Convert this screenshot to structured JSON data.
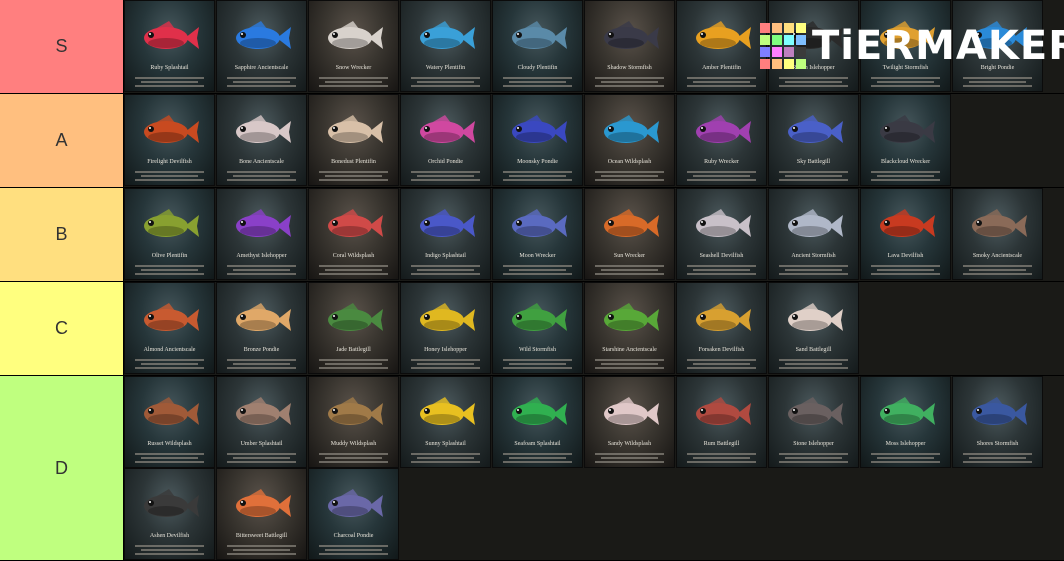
{
  "logo": {
    "text": "TiERMAKER",
    "grid_colors": [
      "#ff7f7f",
      "#ffbf7f",
      "#ffdf7f",
      "#ffff7f",
      "#bfff7f",
      "#7fff7f",
      "#7fffff",
      "#7fbfff",
      "#7f7fff",
      "#ff7fff",
      "#bf7fbf",
      "#3b3b3b",
      "#ff7f7f",
      "#ffbf7f",
      "#ffff7f",
      "#bfff7f"
    ]
  },
  "tiers": [
    {
      "label": "S",
      "color": "#ff7f7f",
      "items": [
        {
          "name": "Ruby Splashtail",
          "color": "#e0304a"
        },
        {
          "name": "Sapphire Ancientscale",
          "color": "#2a7ae0"
        },
        {
          "name": "Snow Wrecker",
          "color": "#d8d2cc"
        },
        {
          "name": "Watery Plentifin",
          "color": "#3aa0d8"
        },
        {
          "name": "Cloudy Plentifin",
          "color": "#5a8aa8"
        },
        {
          "name": "Shadow Stormfish",
          "color": "#3a3a48"
        },
        {
          "name": "Amber Plentifin",
          "color": "#e8a020"
        },
        {
          "name": "Raven Islehopper",
          "color": "#2a2a2a"
        },
        {
          "name": "Twilight Stormfish",
          "color": "#e0a030"
        },
        {
          "name": "Bright Pondie",
          "color": "#2a8ad8"
        }
      ]
    },
    {
      "label": "A",
      "color": "#ffbf7f",
      "items": [
        {
          "name": "Firelight Devilfish",
          "color": "#c84a20"
        },
        {
          "name": "Bone Ancientscale",
          "color": "#d8c8c8"
        },
        {
          "name": "Bonedust Plentifin",
          "color": "#d8c0a8"
        },
        {
          "name": "Orchid Pondie",
          "color": "#d048a0"
        },
        {
          "name": "Moonsky Pondie",
          "color": "#3a48c0"
        },
        {
          "name": "Ocean Wildsplash",
          "color": "#2a98d0"
        },
        {
          "name": "Ruby Wrecker",
          "color": "#a040b0"
        },
        {
          "name": "Sky Battlegill",
          "color": "#4a60c8"
        },
        {
          "name": "Blackcloud Wrecker",
          "color": "#3a3a44"
        }
      ]
    },
    {
      "label": "B",
      "color": "#ffdf7f",
      "items": [
        {
          "name": "Olive Plentifin",
          "color": "#88a030"
        },
        {
          "name": "Amethyst Islehopper",
          "color": "#8a40c8"
        },
        {
          "name": "Coral Wildsplash",
          "color": "#d04a48"
        },
        {
          "name": "Indigo Splashtail",
          "color": "#4a58c8"
        },
        {
          "name": "Moon Wrecker",
          "color": "#5a6ac0"
        },
        {
          "name": "Sun Wrecker",
          "color": "#d86a28"
        },
        {
          "name": "Seashell Devilfish",
          "color": "#c8c0c8"
        },
        {
          "name": "Ancient Stormfish",
          "color": "#b0b8c8"
        },
        {
          "name": "Lava Devilfish",
          "color": "#c83a20"
        },
        {
          "name": "Smoky Ancientscale",
          "color": "#8a6a58"
        }
      ]
    },
    {
      "label": "C",
      "color": "#ffff7f",
      "items": [
        {
          "name": "Almond Ancientscale",
          "color": "#c85a30"
        },
        {
          "name": "Bronze Pondie",
          "color": "#e0a868"
        },
        {
          "name": "Jade Battlegill",
          "color": "#4a8a40"
        },
        {
          "name": "Honey Islehopper",
          "color": "#e0b820"
        },
        {
          "name": "Wild Stormfish",
          "color": "#40a040"
        },
        {
          "name": "Starshine Ancientscale",
          "color": "#58a838"
        },
        {
          "name": "Forsaken Devilfish",
          "color": "#d8a030"
        },
        {
          "name": "Sand Battlegill",
          "color": "#e0d0c8"
        }
      ]
    },
    {
      "label": "D",
      "color": "#bfff7f",
      "items": [
        {
          "name": "Russet Wildsplash",
          "color": "#a05a38"
        },
        {
          "name": "Umber Splashtail",
          "color": "#a08070"
        },
        {
          "name": "Muddy Wildsplash",
          "color": "#a07a48"
        },
        {
          "name": "Sunny Splashtail",
          "color": "#e8c020"
        },
        {
          "name": "Seafoam Splashtail",
          "color": "#30b050"
        },
        {
          "name": "Sandy Wildsplash",
          "color": "#e0c8c8"
        },
        {
          "name": "Rum Battlegill",
          "color": "#b04a40"
        },
        {
          "name": "Stone Islehopper",
          "color": "#6a6060"
        },
        {
          "name": "Moss Islehopper",
          "color": "#40b060"
        },
        {
          "name": "Shores Stormfish",
          "color": "#3a58a0"
        },
        {
          "name": "Ashen Devilfish",
          "color": "#3a3a3a"
        },
        {
          "name": "Bittersweet Battlegill",
          "color": "#e0703a"
        },
        {
          "name": "Charcoal Pondie",
          "color": "#6a68a8"
        }
      ]
    }
  ]
}
